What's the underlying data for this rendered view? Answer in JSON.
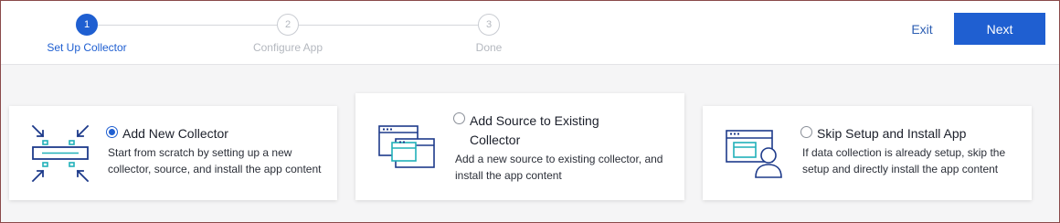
{
  "steps": [
    {
      "number": "1",
      "label": "Set Up Collector",
      "state": "active"
    },
    {
      "number": "2",
      "label": "Configure App",
      "state": "inactive"
    },
    {
      "number": "3",
      "label": "Done",
      "state": "inactive"
    }
  ],
  "header": {
    "exit_label": "Exit",
    "next_label": "Next"
  },
  "colors": {
    "accent": "#1f5fd1",
    "icon_navy": "#1d3a8a",
    "icon_teal": "#21b1b9"
  },
  "options": [
    {
      "title": "Add New Collector",
      "description": "Start from scratch by setting up a new collector, source, and install the app content",
      "selected": true,
      "icon": "collector-compress-icon"
    },
    {
      "title": "Add Source to Existing Collector",
      "description": "Add a new source to existing collector, and install the app content",
      "selected": false,
      "icon": "stacked-windows-icon"
    },
    {
      "title": "Skip Setup and Install App",
      "description": "If data collection is already setup, skip the setup and directly install the app content",
      "selected": false,
      "icon": "window-user-icon"
    }
  ]
}
